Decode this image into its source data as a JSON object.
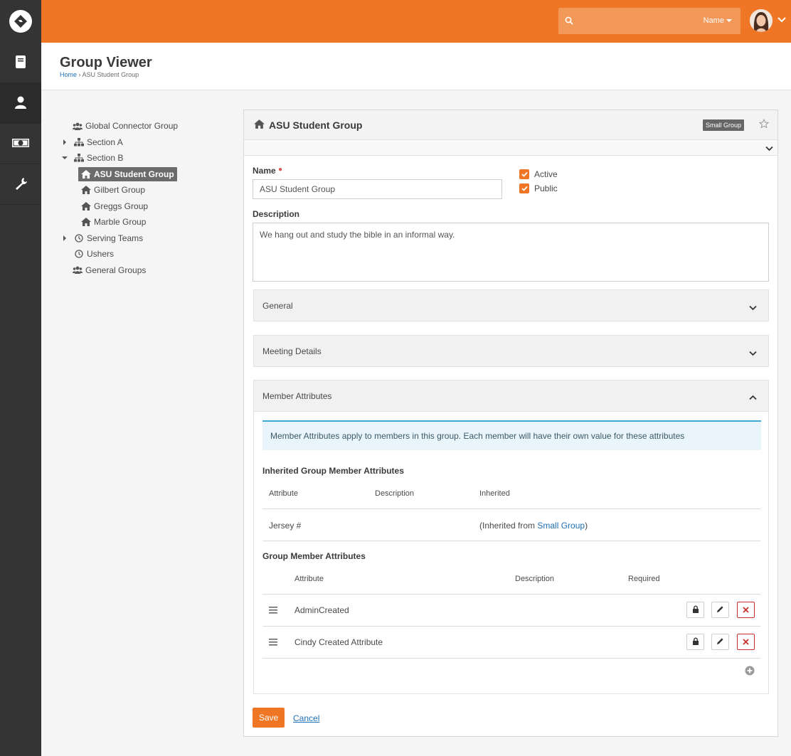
{
  "app": {
    "name": "Rock RMS"
  },
  "sidebar": {
    "items": [
      {
        "icon": "book-icon"
      },
      {
        "icon": "person-icon"
      },
      {
        "icon": "money-icon"
      },
      {
        "icon": "wrench-icon"
      }
    ]
  },
  "header": {
    "search_placeholder": "",
    "search_filter_label": "Name"
  },
  "page": {
    "title": "Group Viewer",
    "breadcrumb": [
      {
        "label": "Home"
      },
      {
        "label": "ASU Student Group"
      }
    ]
  },
  "tree": [
    {
      "label": "Global Connector Group",
      "icon": "users-icon"
    },
    {
      "label": "Section A",
      "icon": "sitemap-icon"
    },
    {
      "label": "Section B",
      "icon": "sitemap-icon"
    },
    {
      "label": "ASU Student Group",
      "icon": "home-icon"
    },
    {
      "label": "Gilbert Group",
      "icon": "home-icon"
    },
    {
      "label": "Greggs Group",
      "icon": "home-icon"
    },
    {
      "label": "Marble Group",
      "icon": "home-icon"
    },
    {
      "label": "Serving Teams",
      "icon": "clock-icon"
    },
    {
      "label": "Ushers",
      "icon": "clock-icon"
    },
    {
      "label": "General Groups",
      "icon": "users-icon"
    }
  ],
  "panel": {
    "title": "ASU Student Group",
    "group_type": "Small Group",
    "name_label": "Name",
    "name_value": "ASU Student Group",
    "active_label": "Active",
    "public_label": "Public",
    "description_label": "Description",
    "description_value": "We hang out and study the bible in an informal way.",
    "sections": {
      "general": "General",
      "meeting": "Meeting Details",
      "member_attributes": "Member Attributes"
    },
    "member_info": "Member Attributes apply to members in this group. Each member will have their own value for these attributes",
    "inherited": {
      "heading": "Inherited Group Member Attributes",
      "col_attribute": "Attribute",
      "col_description": "Description",
      "col_inherited": "Inherited",
      "row_attribute": "Jersey #",
      "row_inherited_prefix": "(Inherited from ",
      "row_inherited_link": "Small Group",
      "row_inherited_suffix": ")"
    },
    "group_member": {
      "heading": "Group Member Attributes",
      "col_attribute": "Attribute",
      "col_description": "Description",
      "col_required": "Required",
      "rows": [
        {
          "attribute": "AdminCreated"
        },
        {
          "attribute": "Cindy Created Attribute"
        }
      ]
    },
    "save_label": "Save",
    "cancel_label": "Cancel"
  },
  "colors": {
    "accent": "#ee7625",
    "sidebar": "#343434",
    "link": "#1e6fb5",
    "danger": "#c9302c"
  }
}
